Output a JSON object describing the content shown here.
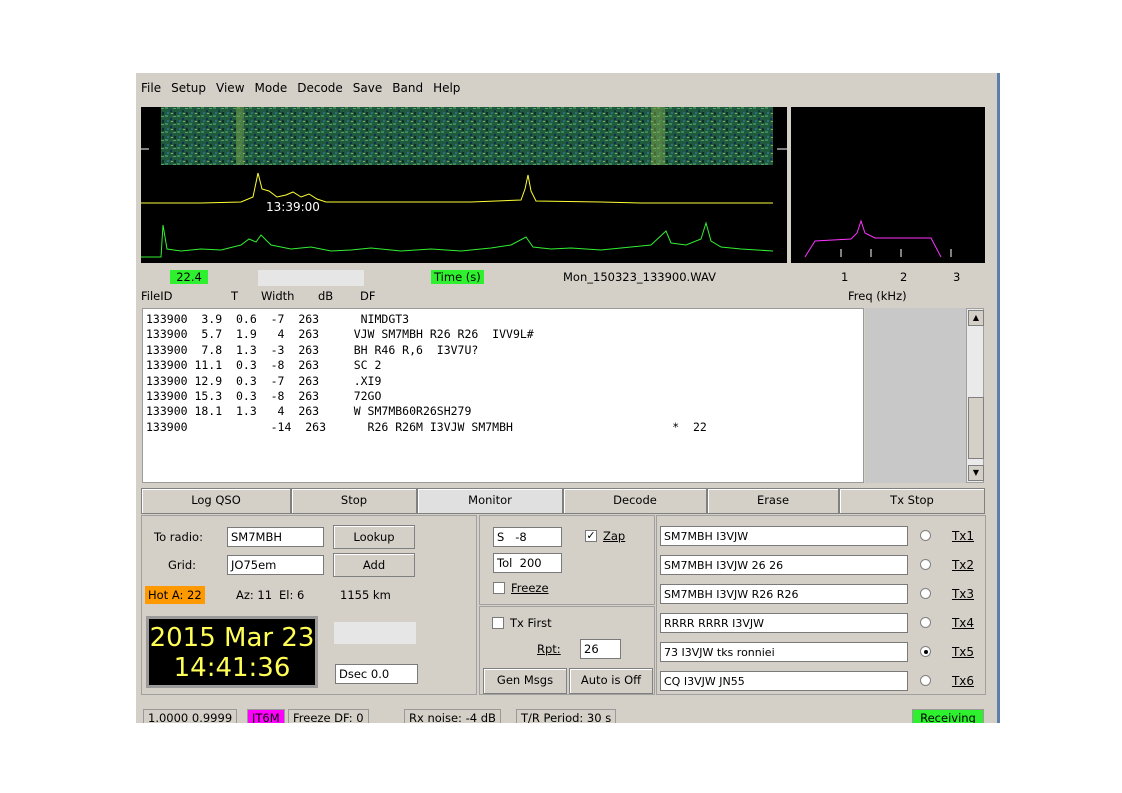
{
  "menu": [
    "File",
    "Setup",
    "View",
    "Mode",
    "Decode",
    "Save",
    "Band",
    "Help"
  ],
  "waterfall": {
    "timestamp": "13:39:00"
  },
  "info_bar": {
    "value": "22.4",
    "time_label": "Time (s)",
    "filename": "Mon_150323_133900.WAV",
    "freq_ticks": [
      "1",
      "2",
      "3"
    ],
    "freq_label": "Freq (kHz)"
  },
  "columns": [
    "FileID",
    "T",
    "Width",
    "dB",
    "DF"
  ],
  "decodes": [
    "133900  3.9  0.6  -7  263      NIMDGT3",
    "133900  5.7  1.9   4  263     VJW SM7MBH R26 R26  IVV9L#",
    "133900  7.8  1.3  -3  263     BH R46 R,6  I3V7U?",
    "133900 11.1  0.3  -8  263     SC 2",
    "133900 12.9  0.3  -7  263     .XI9",
    "133900 15.3  0.3  -8  263     72GO",
    "133900 18.1  1.3   4  263     W SM7MB60R26SH279",
    "133900            -14  263      R26 R26M I3VJW SM7MBH                       *  22"
  ],
  "toolbar": {
    "log_qso": "Log QSO",
    "stop": "Stop",
    "monitor": "Monitor",
    "decode": "Decode",
    "erase": "Erase",
    "tx_stop": "Tx Stop"
  },
  "station": {
    "to_radio_label": "To radio:",
    "to_radio": "SM7MBH",
    "lookup": "Lookup",
    "grid_label": "Grid:",
    "grid": "JO75em",
    "add": "Add",
    "hot": "Hot A: 22",
    "az": "Az: 11",
    "el": "El: 6",
    "distance": "1155 km",
    "date": "2015 Mar 23",
    "time": "14:41:36",
    "dsec": "Dsec 0.0"
  },
  "controls": {
    "s_label": "S",
    "s_value": "-8",
    "zap": "Zap",
    "zap_checked": "✓",
    "tol_label": "Tol",
    "tol_value": "200",
    "freeze": "Freeze",
    "tx_first": "Tx First",
    "rpt_label": "Rpt:",
    "rpt_value": "26",
    "gen_msgs": "Gen Msgs",
    "auto": "Auto is Off"
  },
  "messages": [
    {
      "text": "SM7MBH I3VJW",
      "btn": "Tx1"
    },
    {
      "text": "SM7MBH I3VJW 26 26",
      "btn": "Tx2"
    },
    {
      "text": "SM7MBH I3VJW R26 R26",
      "btn": "Tx3"
    },
    {
      "text": "RRRR RRRR I3VJW",
      "btn": "Tx4"
    },
    {
      "text": "73 I3VJW tks ronniei",
      "btn": "Tx5"
    },
    {
      "text": "CQ I3VJW JN55",
      "btn": "Tx6"
    }
  ],
  "status": {
    "values": "1.0000 0.9999",
    "mode": "JT6M",
    "freeze_df": "Freeze DF:   0",
    "rx_noise": "Rx noise: -4 dB",
    "tr_period": "T/R Period: 30 s",
    "state": "Receiving"
  },
  "colors": {
    "green": "#2ef02e",
    "mode": "#ff00ff",
    "hot": "#ff9900",
    "clock_text": "#ffff55",
    "trace": "#ffff33",
    "spectrum": "#ff33ff"
  }
}
